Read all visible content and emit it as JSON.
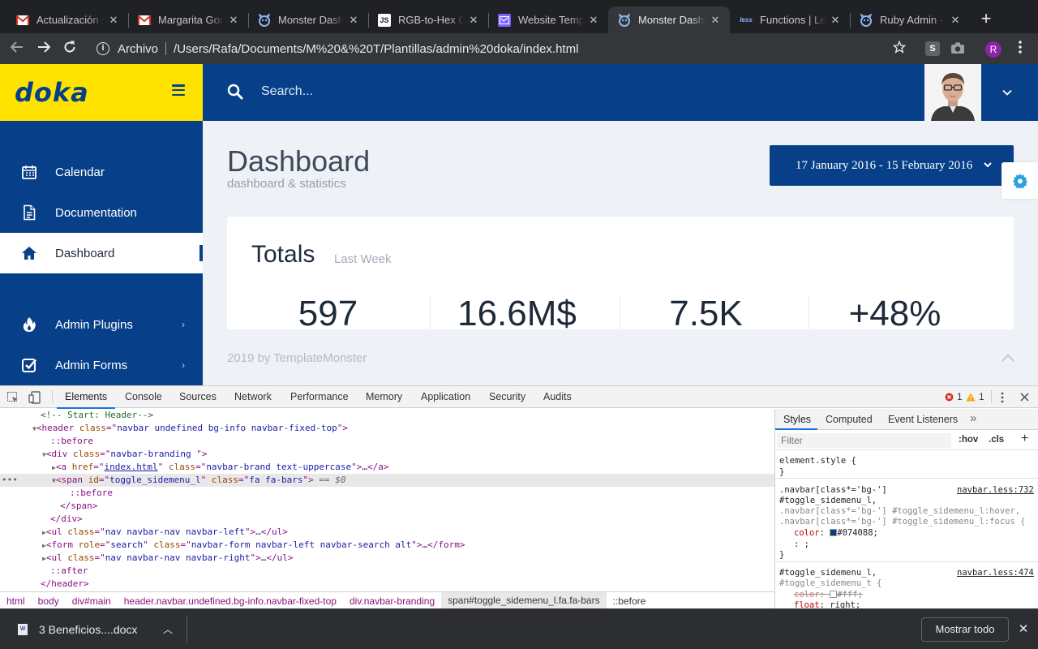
{
  "browser": {
    "tabs": [
      {
        "title": "Actualización sobre",
        "icon": "gmail-icon"
      },
      {
        "title": "Margarita González",
        "icon": "gmail-icon"
      },
      {
        "title": "Monster Dashboard",
        "icon": "monster-icon"
      },
      {
        "title": "RGB-to-Hex Converter",
        "icon": "js-icon"
      },
      {
        "title": "Website Templates",
        "icon": "templates-icon"
      },
      {
        "title": "Monster Dashboard",
        "icon": "monster-icon",
        "active": true
      },
      {
        "title": "Functions | Less",
        "icon": "less-icon"
      },
      {
        "title": "Ruby Admin - Admin",
        "icon": "monster-icon"
      }
    ],
    "address_scheme": "Archivo",
    "address_url": "/Users/Rafa/Documents/M%20&%20T/Plantillas/admin%20doka/index.html",
    "profile_initial": "R"
  },
  "app": {
    "logo": "doka",
    "search_placeholder": "Search...",
    "sidebar": [
      {
        "label": "Calendar",
        "icon": "calendar-icon"
      },
      {
        "label": "Documentation",
        "icon": "document-icon"
      },
      {
        "label": "Dashboard",
        "icon": "home-icon",
        "active": true
      },
      {
        "label": "Admin Plugins",
        "icon": "fire-icon",
        "chevron": true
      },
      {
        "label": "Admin Forms",
        "icon": "checkbox-icon",
        "chevron": true
      }
    ],
    "page_title": "Dashboard",
    "page_subtitle": "dashboard & statistics",
    "date_range": "17 January 2016 - 15 February 2016",
    "totals": {
      "title": "Totals",
      "subtitle": "Last Week",
      "stats": [
        "597",
        "16.6M$",
        "7.5K",
        "+48%"
      ]
    },
    "footer": "2019 by TemplateMonster"
  },
  "devtools": {
    "tabs": [
      "Elements",
      "Console",
      "Sources",
      "Network",
      "Performance",
      "Memory",
      "Application",
      "Security",
      "Audits"
    ],
    "active_tab": "Elements",
    "errors": "1",
    "warnings": "1",
    "breadcrumbs": [
      "html",
      "body",
      "div#main",
      "header.navbar.undefined.bg-info.navbar-fixed-top",
      "div.navbar-branding",
      "span#toggle_sidemenu_l.fa.fa-bars",
      "::before"
    ],
    "styles_tabs": [
      "Styles",
      "Computed",
      "Event Listeners"
    ],
    "styles_filter_placeholder": "Filter",
    "styles_hov": ":hov",
    "styles_cls": ".cls",
    "rules": {
      "element_style": "element.style {",
      "close": "}",
      "rule1_selector1": ".navbar[class*='bg-']",
      "rule1_selector2": "#toggle_sidemenu_l,",
      "rule1_selector3": ".navbar[class*='bg-'] #toggle_sidemenu_l:hover,",
      "rule1_selector4": ".navbar[class*='bg-'] #toggle_sidemenu_l:focus {",
      "rule1_source": "navbar.less:732",
      "rule1_prop": "color",
      "rule1_value": "#074088;",
      "rule1_extra": ": ;",
      "rule2_selector1": "#toggle_sidemenu_l,",
      "rule2_selector2": "#toggle_sidemenu_t {",
      "rule2_source": "navbar.less:474",
      "rule2_prop1": "color",
      "rule2_value1": "#fff;",
      "rule2_prop2": "float",
      "rule2_value2": "right;"
    },
    "colors": {
      "swatch_blue": "#074088",
      "swatch_white": "#ffffff"
    }
  },
  "downloads": {
    "file": "3 Beneficios....docx",
    "show_all": "Mostrar todo"
  },
  "colors": {
    "brand_yellow": "#ffe300",
    "brand_blue": "#074088",
    "page_bg": "#eef1f5"
  }
}
